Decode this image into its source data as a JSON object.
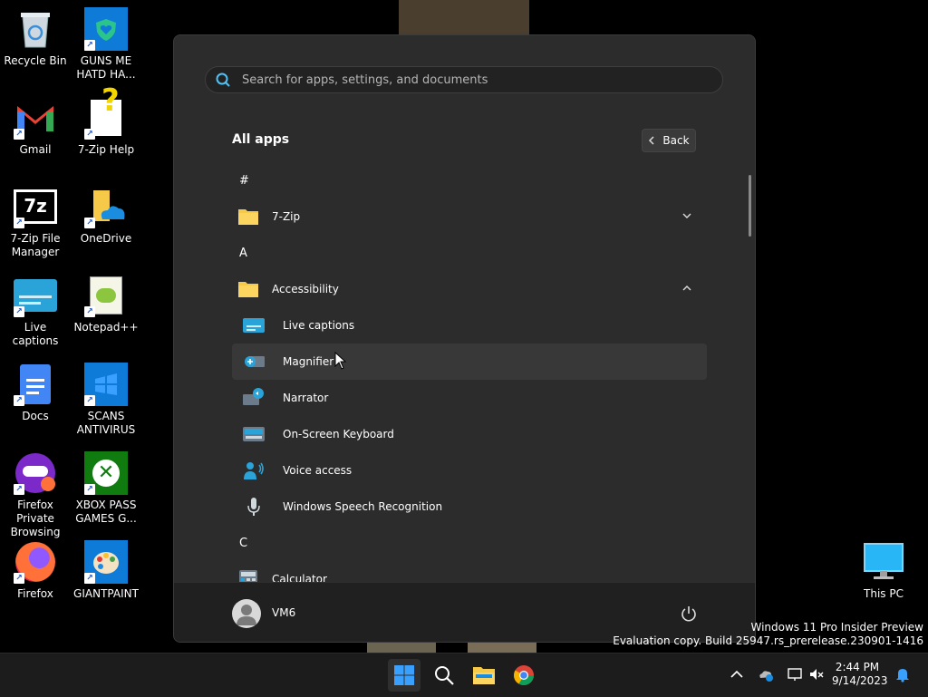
{
  "desktop": {
    "icons": [
      {
        "label": "Recycle Bin"
      },
      {
        "label": "GUNS ME HATD HA..."
      },
      {
        "label": "Gmail"
      },
      {
        "label": "7-Zip Help"
      },
      {
        "label": "7-Zip File Manager"
      },
      {
        "label": "OneDrive"
      },
      {
        "label": "Live captions"
      },
      {
        "label": "Notepad++"
      },
      {
        "label": "Docs"
      },
      {
        "label": "SCANS ANTIVIRUS"
      },
      {
        "label": "Firefox Private Browsing"
      },
      {
        "label": "XBOX PASS GAMES G..."
      },
      {
        "label": "Firefox"
      },
      {
        "label": "GIANTPAINT"
      },
      {
        "label": "This PC"
      }
    ],
    "watermark": {
      "line1": "Windows 11 Pro Insider Preview",
      "line2": "Evaluation copy. Build 25947.rs_prerelease.230901-1416"
    }
  },
  "start_menu": {
    "search": {
      "placeholder": "Search for apps, settings, and documents"
    },
    "title": "All apps",
    "back_label": "Back",
    "list": [
      {
        "type": "letter",
        "label": "#"
      },
      {
        "type": "folder",
        "label": "7-Zip",
        "expanded": false
      },
      {
        "type": "letter",
        "label": "A"
      },
      {
        "type": "folder",
        "label": "Accessibility",
        "expanded": true
      },
      {
        "type": "app",
        "label": "Live captions"
      },
      {
        "type": "app",
        "label": "Magnifier"
      },
      {
        "type": "app",
        "label": "Narrator"
      },
      {
        "type": "app",
        "label": "On-Screen Keyboard"
      },
      {
        "type": "app",
        "label": "Voice access"
      },
      {
        "type": "app",
        "label": "Windows Speech Recognition"
      },
      {
        "type": "letter",
        "label": "C"
      },
      {
        "type": "app-top",
        "label": "Calculator"
      }
    ],
    "user": {
      "name": "VM6"
    }
  },
  "taskbar": {
    "clock": {
      "time": "2:44 PM",
      "date": "9/14/2023"
    },
    "apps": [
      "start-icon",
      "search-icon",
      "file-explorer-icon",
      "chrome-icon"
    ]
  },
  "colors": {
    "accent": "#0078d4",
    "menu_bg": "#2c2c2c",
    "footer_bg": "#202020",
    "taskbar_bg": "#1c1c1c"
  }
}
